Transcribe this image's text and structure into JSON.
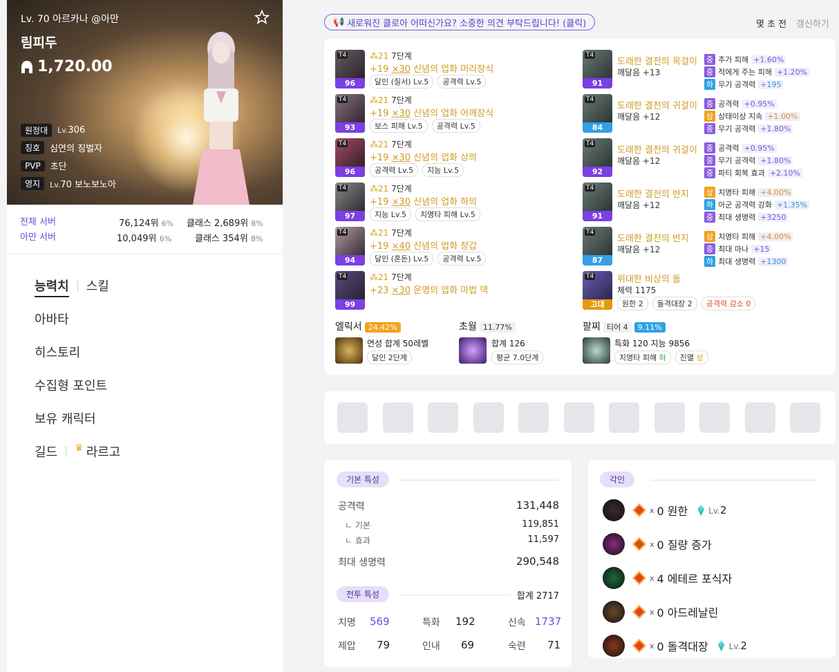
{
  "profile": {
    "level_line": "Lv. 70 아르카나 @아만",
    "name": "림피두",
    "item_level": "1,720.00",
    "rows": [
      {
        "tag": "원정대",
        "small": "Lv.",
        "val": "306"
      },
      {
        "tag": "칭호",
        "small": "",
        "val": "심연의 징벌자"
      },
      {
        "tag": "PVP",
        "small": "",
        "val": "초단"
      },
      {
        "tag": "영지",
        "small": "Lv.",
        "val": "70 보노보노아"
      }
    ]
  },
  "ranking": [
    {
      "label": "전체 서버",
      "rank": "76,124위",
      "pct": "6%",
      "cls": "클래스 2,689위",
      "cpct": "8%"
    },
    {
      "label": "아만 서버",
      "rank": "10,049위",
      "pct": "6%",
      "cls": "클래스 354위",
      "cpct": "8%"
    }
  ],
  "menu": {
    "stats": "능력치",
    "skills": "스킬",
    "avatar": "아바타",
    "history": "히스토리",
    "collect": "수집형 포인트",
    "chars": "보유 캐릭터",
    "guild": "길드",
    "guild_name": "라르고"
  },
  "notice": "새로워진 클로아 어떠신가요? 소중한 의견 부탁드립니다! (클릭)",
  "time": "몇 초 전",
  "refresh": "갱신하기",
  "equipment": [
    {
      "q": "96",
      "star": "21",
      "stage": "7단계",
      "up": "+19",
      "x": "×30",
      "name": "신념의 업화 머리장식",
      "chips": [
        "달인 (질서) Lv.5",
        "공격력 Lv.5"
      ]
    },
    {
      "q": "93",
      "star": "21",
      "stage": "7단계",
      "up": "+19",
      "x": "×30",
      "name": "신념의 업화 어깨장식",
      "chips": [
        "보스 피해 Lv.5",
        "공격력 Lv.5"
      ]
    },
    {
      "q": "96",
      "star": "21",
      "stage": "7단계",
      "up": "+19",
      "x": "×30",
      "name": "신념의 업화 상의",
      "chips": [
        "공격력 Lv.5",
        "지능 Lv.5"
      ]
    },
    {
      "q": "97",
      "star": "21",
      "stage": "7단계",
      "up": "+19",
      "x": "×30",
      "name": "신념의 업화 하의",
      "chips": [
        "지능 Lv.5",
        "치명타 피해 Lv.5"
      ]
    },
    {
      "q": "94",
      "star": "21",
      "stage": "7단계",
      "up": "+19",
      "x": "×40",
      "name": "신념의 업화 장갑",
      "chips": [
        "달인 (혼돈) Lv.5",
        "공격력 Lv.5"
      ]
    },
    {
      "q": "99",
      "star": "21",
      "stage": "7단계",
      "up": "+23",
      "x": "×30",
      "name": "운명의 업화 마법 덱",
      "chips": []
    }
  ],
  "accessories": [
    {
      "q": "91",
      "name": "도래한 결전의 목걸이",
      "sub": "깨달음 +13",
      "opts": [
        {
          "g": "중",
          "t": "추가 피해",
          "v": "+1.60%"
        },
        {
          "g": "중",
          "t": "적에게 주는 피해",
          "v": "+1.20%"
        },
        {
          "g": "하",
          "t": "무기 공격력",
          "v": "+195"
        }
      ]
    },
    {
      "q": "84",
      "name": "도래한 결전의 귀걸이",
      "sub": "깨달음 +12",
      "opts": [
        {
          "g": "중",
          "t": "공격력",
          "v": "+0.95%"
        },
        {
          "g": "상",
          "t": "상태이상 지속",
          "v": "+1.00%"
        },
        {
          "g": "중",
          "t": "무기 공격력",
          "v": "+1.80%"
        }
      ]
    },
    {
      "q": "92",
      "name": "도래한 결전의 귀걸이",
      "sub": "깨달음 +12",
      "opts": [
        {
          "g": "중",
          "t": "공격력",
          "v": "+0.95%"
        },
        {
          "g": "중",
          "t": "무기 공격력",
          "v": "+1.80%"
        },
        {
          "g": "중",
          "t": "파티 회복 효과",
          "v": "+2.10%"
        }
      ]
    },
    {
      "q": "91",
      "name": "도래한 결전의 반지",
      "sub": "깨달음 +12",
      "opts": [
        {
          "g": "상",
          "t": "치명타 피해",
          "v": "+4.00%"
        },
        {
          "g": "하",
          "t": "아군 공격력 강화",
          "v": "+1.35%"
        },
        {
          "g": "중",
          "t": "최대 생명력",
          "v": "+3250"
        }
      ]
    },
    {
      "q": "87",
      "name": "도래한 결전의 반지",
      "sub": "깨달음 +12",
      "opts": [
        {
          "g": "상",
          "t": "치명타 피해",
          "v": "+4.00%"
        },
        {
          "g": "중",
          "t": "최대 마나",
          "v": "+15"
        },
        {
          "g": "하",
          "t": "최대 생명력",
          "v": "+1300"
        }
      ]
    }
  ],
  "stone": {
    "grade": "고대",
    "name": "위대한 비상의 돌",
    "sub": "체력 1175",
    "chips": [
      "원한 2",
      "돌격대장 2"
    ],
    "neg": "공격력 감소 0"
  },
  "elixir": {
    "title": "엘릭서",
    "pct": "24.42%",
    "line": "연성 합계 50레벨",
    "chip": "달인 2단계"
  },
  "transc": {
    "title": "초월",
    "pct": "11.77%",
    "line": "합계 126",
    "chip": "평균 7.0단계"
  },
  "bracelet": {
    "title": "팔찌",
    "tier": "티어 4",
    "pct": "9.11%",
    "line": "특화 120 지능 9856",
    "c1": "치명타 피해",
    "c1g": "하",
    "c2": "진멸",
    "c2g": "상"
  },
  "basic": {
    "title": "기본 특성",
    "atk_l": "공격력",
    "atk": "131,448",
    "base_l": "ㄴ 기본",
    "base": "119,851",
    "eff_l": "ㄴ 효과",
    "eff": "11,597",
    "hp_l": "최대 생명력",
    "hp": "290,548"
  },
  "combat": {
    "title": "전투 특성",
    "total": "합계 2717",
    "crit_l": "치명",
    "crit": "569",
    "spec_l": "특화",
    "spec": "192",
    "swift_l": "신속",
    "swift": "1737",
    "dom_l": "제압",
    "dom": "79",
    "end_l": "인내",
    "end": "69",
    "exp_l": "숙련",
    "exp": "71"
  },
  "engravings": {
    "title": "각인",
    "items": [
      {
        "x": "x",
        "n": "0 원한",
        "lv": "Lv.",
        "lvn": "2"
      },
      {
        "x": "x",
        "n": "0 질량 증가",
        "lv": "",
        "lvn": ""
      },
      {
        "x": "x",
        "n": "4 에테르 포식자",
        "lv": "",
        "lvn": ""
      },
      {
        "x": "x",
        "n": "0 아드레날린",
        "lv": "",
        "lvn": ""
      },
      {
        "x": "x",
        "n": "0 돌격대장",
        "lv": "Lv.",
        "lvn": "2"
      }
    ]
  },
  "colors": {
    "accent": "#6e4be0",
    "gold": "#d09a23",
    "relic": "#7b3fe4",
    "ancient": "#e39b0a"
  }
}
